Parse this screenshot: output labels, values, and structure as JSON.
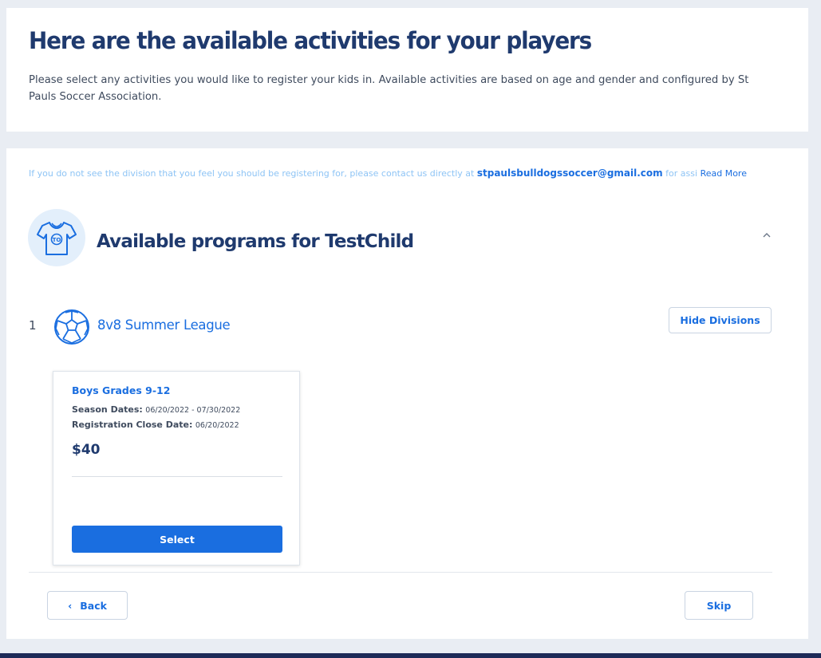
{
  "header": {
    "title": "Here are the available activities for your players",
    "subtitle": "Please select any activities you would like to register your kids in. Available activities are based on age and gender and configured by St Pauls Soccer Association."
  },
  "notice": {
    "text_before": "If you do not see the division that you feel you should be registering for, please contact us directly at ",
    "email": "stpaulsbulldogssoccer@gmail.com",
    "text_after": " for assi",
    "read_more": "Read More"
  },
  "programs": {
    "title": "Available programs for TestChild",
    "shirt_icon_text": "TO",
    "collapse_icon": "chevron-up-icon",
    "items": [
      {
        "index": "1",
        "name": "8v8 Summer League",
        "hide_divisions_label": "Hide Divisions",
        "divisions": [
          {
            "name": "Boys Grades 9-12",
            "season_label": "Season Dates:",
            "season_value": "06/20/2022 - 07/30/2022",
            "close_label": "Registration Close Date:",
            "close_value": "06/20/2022",
            "price": "$40",
            "select_label": "Select"
          }
        ]
      }
    ]
  },
  "footer": {
    "back_label": "Back",
    "skip_label": "Skip"
  },
  "colors": {
    "accent": "#1a6ee0",
    "heading": "#1f3a6e",
    "background": "#e9edf3",
    "bottom_bar": "#1d2a57"
  }
}
